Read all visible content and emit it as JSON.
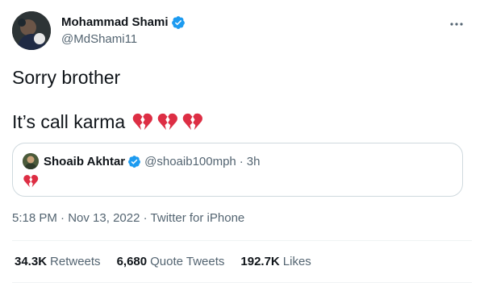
{
  "author": {
    "name": "Mohammad Shami",
    "handle": "@MdShami11"
  },
  "tweet": {
    "line1": "Sorry brother",
    "line2": "It’s call karma",
    "emoji": "broken-heart-icon"
  },
  "quote": {
    "name": "Shoaib Akhtar",
    "handle": "@shoaib100mph",
    "separator": "·",
    "time": "3h",
    "emoji": "broken-heart-icon"
  },
  "meta": {
    "time": "5:18 PM",
    "sep1": "·",
    "date": "Nov 13, 2022",
    "sep2": "·",
    "source": "Twitter for iPhone"
  },
  "stats": {
    "retweets_count": "34.3K",
    "retweets_label": "Retweets",
    "quotes_count": "6,680",
    "quotes_label": "Quote Tweets",
    "likes_count": "192.7K",
    "likes_label": "Likes"
  },
  "colors": {
    "verified": "#1d9bf0",
    "heart": "#dd2e44",
    "secondary_text": "#536471",
    "border": "#cfd9de"
  }
}
